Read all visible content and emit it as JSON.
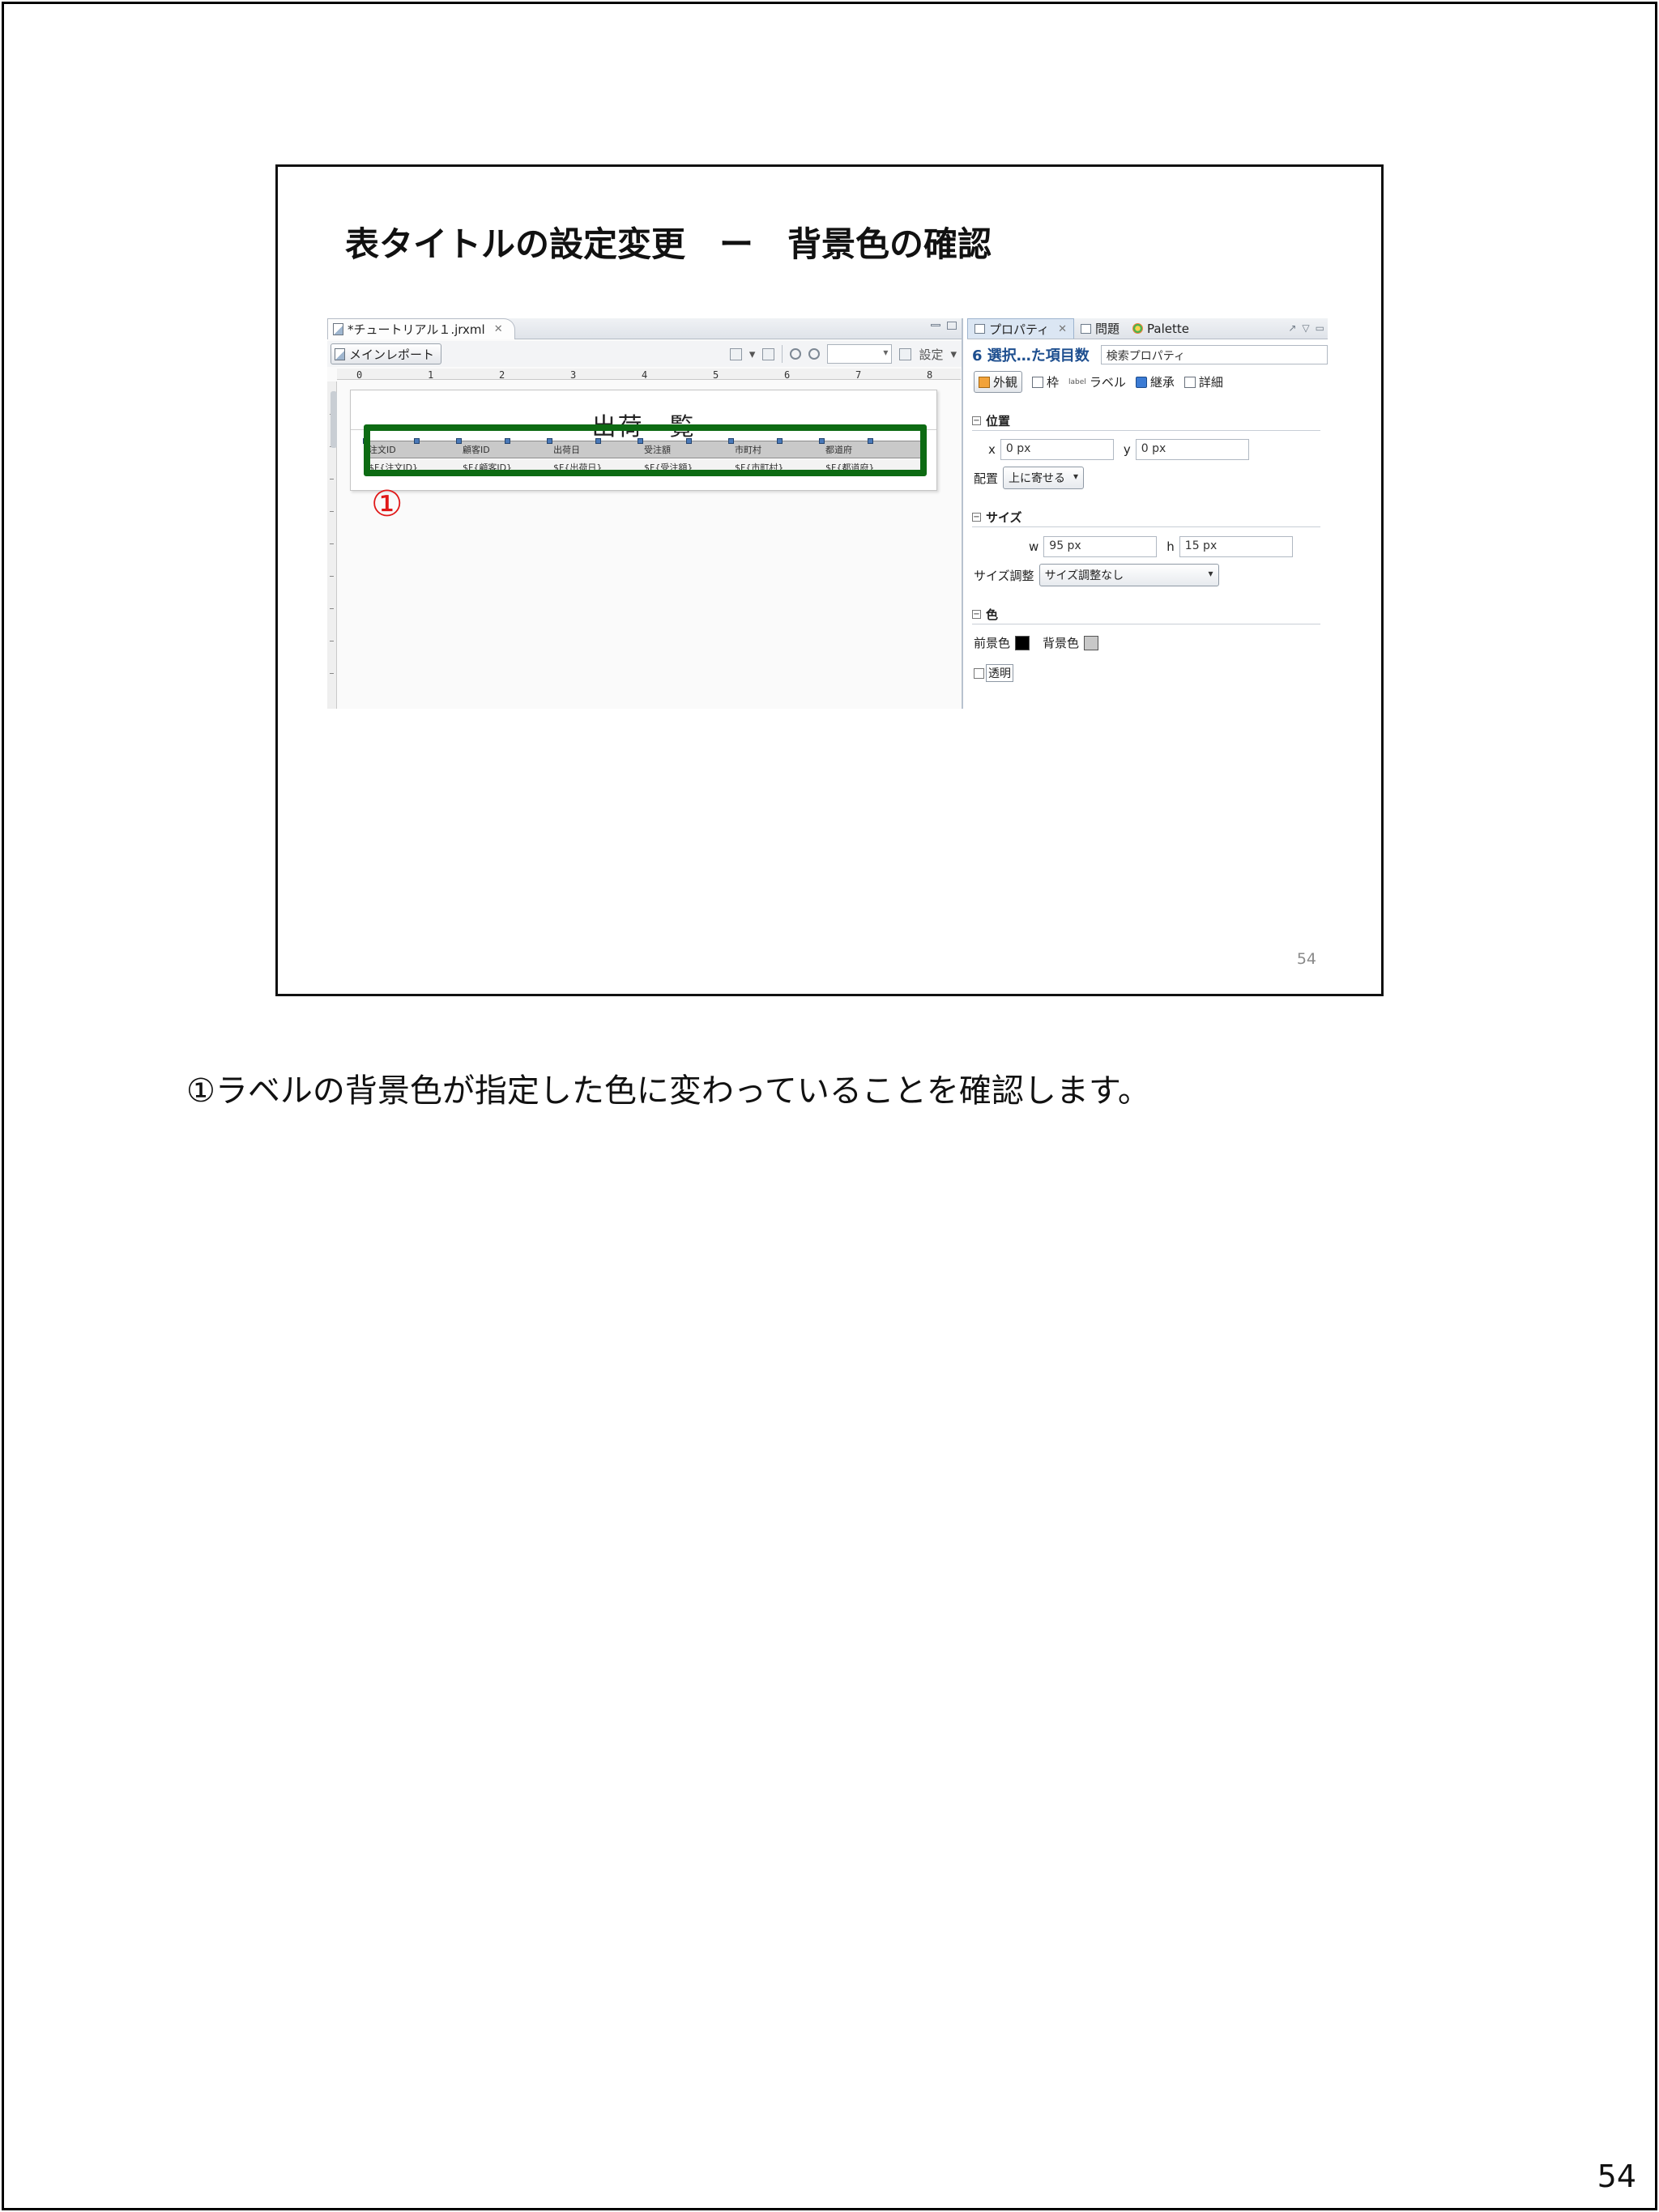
{
  "page": {
    "number": "54"
  },
  "slide": {
    "title": "表タイトルの設定変更　ー　背景色の確認",
    "slide_number": "54"
  },
  "note": "①ラベルの背景色が指定した色に変わっていることを確認します。",
  "editor": {
    "tab_label": "*チュートリアル１.jrxml",
    "main_report_button": "メインレポート",
    "settings_label": "設定",
    "ruler_ticks": [
      "0",
      "1",
      "2",
      "3",
      "4",
      "5",
      "6",
      "7",
      "8"
    ],
    "report_title": "出荷一覧",
    "label_cells": [
      "注文ID",
      "顧客ID",
      "出荷日",
      "受注額",
      "市町村",
      "都道府"
    ],
    "field_cells": [
      "$F{注文ID}",
      "$F{顧客ID}",
      "$F{出荷日}",
      "$F{受注額}",
      "$F{市町村}",
      "$F{都道府}"
    ],
    "marker": "①",
    "highlight_color": "#0d6b13",
    "marker_color": "#e01818"
  },
  "properties": {
    "tabs": [
      {
        "label": "プロパティ",
        "icon": "properties-icon"
      },
      {
        "label": "問題",
        "icon": "problems-icon"
      },
      {
        "label": "Palette",
        "icon": "palette-icon"
      }
    ],
    "header_title": "6 選択…た項目数",
    "search_placeholder": "検索プロパティ",
    "subtabs": [
      "外観",
      "枠",
      "ラベル",
      "継承",
      "詳細"
    ],
    "label_badge": "label",
    "position": {
      "section": "位置",
      "x_label": "x",
      "x_value": "0 px",
      "y_label": "y",
      "y_value": "0 px",
      "layout_label": "配置",
      "layout_value": "上に寄せる"
    },
    "size": {
      "section": "サイズ",
      "w_label": "w",
      "w_value": "95 px",
      "h_label": "h",
      "h_value": "15 px",
      "adjust_label": "サイズ調整",
      "adjust_value": "サイズ調整なし"
    },
    "color": {
      "section": "色",
      "fg_label": "前景色",
      "fg_color": "#000000",
      "bg_label": "背景色",
      "bg_color": "#c8c8c8",
      "transparent_label": "透明"
    }
  }
}
